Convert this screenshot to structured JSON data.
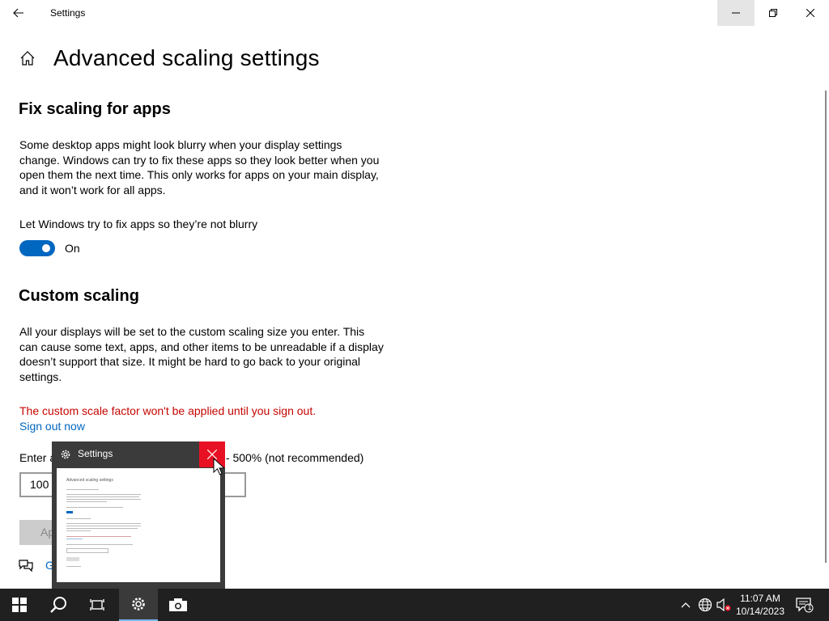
{
  "window": {
    "title": "Settings"
  },
  "page": {
    "title": "Advanced scaling settings"
  },
  "fix_scaling": {
    "heading": "Fix scaling for apps",
    "description": "Some desktop apps might look blurry when your display settings change. Windows can try to fix these apps so they look better when you open them the next time. This only works for apps on your main display, and it won’t work for all apps.",
    "toggle_label": "Let Windows try to fix apps so they’re not blurry",
    "toggle_state": "On",
    "toggle_on": true
  },
  "custom_scaling": {
    "heading": "Custom scaling",
    "description": "All your displays will be set to the custom scaling size you enter. This can cause some text, apps, and other items to be unreadable if a display doesn’t support that size. It might be hard to go back to your original settings.",
    "warning": "The custom scale factor won't be applied until you sign out.",
    "sign_out_link": "Sign out now",
    "input_label_start": "Enter a",
    "input_label_end": "s - 500% (not recommended)",
    "input_value": "100",
    "apply_label": "Ap",
    "feedback_label": "G"
  },
  "preview": {
    "title": "Settings",
    "mini_title": "Advanced scaling settings"
  },
  "taskbar": {
    "time": "11:07 AM",
    "date": "10/14/2023",
    "notification_count": "1"
  },
  "colors": {
    "accent": "#0067c0",
    "warning": "#c50500",
    "close_red": "#e81123",
    "taskbar": "#202020"
  }
}
